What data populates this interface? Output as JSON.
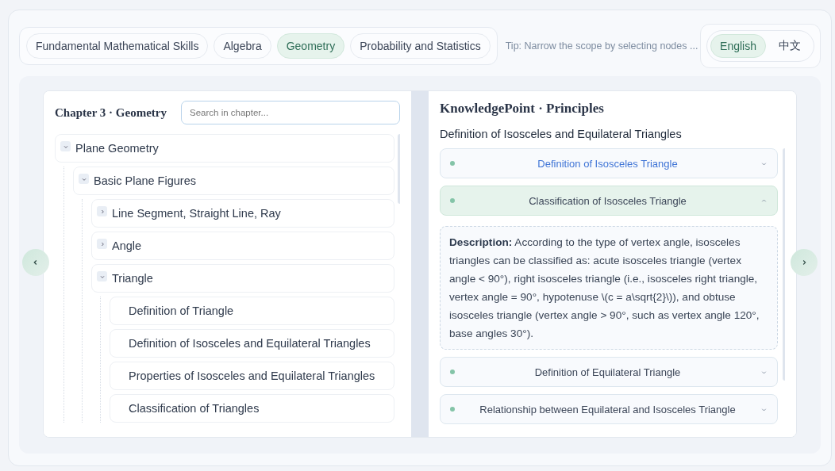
{
  "subjects": [
    {
      "label": "Fundamental Mathematical Skills",
      "selected": false
    },
    {
      "label": "Algebra",
      "selected": false
    },
    {
      "label": "Geometry",
      "selected": true
    },
    {
      "label": "Probability and Statistics",
      "selected": false
    }
  ],
  "tip": "Tip: Narrow the scope by selecting nodes ...",
  "languages": [
    {
      "label": "English",
      "selected": true
    },
    {
      "label": "中文",
      "selected": false
    }
  ],
  "chapter": {
    "title": "Chapter 3 · Geometry",
    "search": {
      "placeholder": "Search in chapter..."
    },
    "tree": [
      {
        "label": "Plane Geometry",
        "kind": "branch",
        "expanded": true,
        "children": [
          {
            "label": "Basic Plane Figures",
            "kind": "branch",
            "expanded": true,
            "children": [
              {
                "label": "Line Segment, Straight Line, Ray",
                "kind": "branch",
                "expanded": false
              },
              {
                "label": "Angle",
                "kind": "branch",
                "expanded": false
              },
              {
                "label": "Triangle",
                "kind": "branch",
                "expanded": true,
                "children": [
                  {
                    "label": "Definition of Triangle",
                    "kind": "leaf"
                  },
                  {
                    "label": "Definition of Isosceles and Equilateral Triangles",
                    "kind": "leaf"
                  },
                  {
                    "label": "Properties of Isosceles and Equilateral Triangles",
                    "kind": "leaf"
                  },
                  {
                    "label": "Classification of Triangles",
                    "kind": "leaf"
                  }
                ]
              }
            ]
          }
        ]
      }
    ]
  },
  "knowledge": {
    "title": "KnowledgePoint · Principles",
    "section": "Definition of Isosceles and Equilateral Triangles",
    "items": [
      {
        "title": "Definition of Isosceles Triangle",
        "expanded": false,
        "highlighted": true
      },
      {
        "title": "Classification of Isosceles Triangle",
        "expanded": true,
        "highlighted": false,
        "description": "**Description:** According to the type of vertex angle, isosceles triangles can be classified as: acute isosceles triangle (vertex angle < 90°), right isosceles triangle (i.e., isosceles right triangle, vertex angle = 90°, hypotenuse \\(c = a\\sqrt{2}\\)), and obtuse isosceles triangle (vertex angle > 90°, such as vertex angle 120°, base angles 30°)."
      },
      {
        "title": "Definition of Equilateral Triangle",
        "expanded": false,
        "highlighted": false
      },
      {
        "title": "Relationship between Equilateral and Isosceles Triangle",
        "expanded": false,
        "highlighted": false
      }
    ]
  }
}
